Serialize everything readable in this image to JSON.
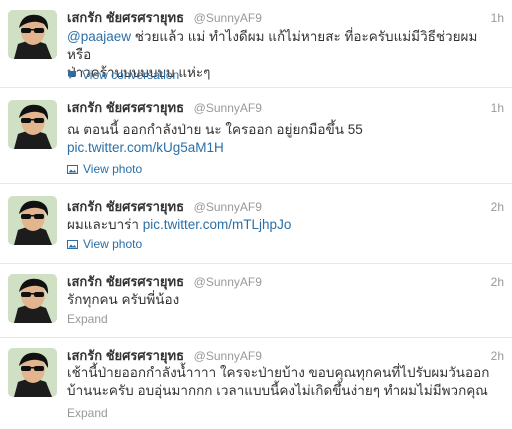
{
  "tweets": [
    {
      "fullname": "เสกรัก ชัยศรศรายุทธ",
      "username": "@SunnyAF9",
      "time": "1h",
      "mention": "@paajaew",
      "text": "ช่วยแล้ว แม่ ทำไงดีผม แก้ไม่หายสะ ที่อะครับแม่มีวิธีช่วยผมหรือ",
      "text2": "ป่าวคร้าบบบบบบบ แห่ะๆ",
      "action": "View conversation",
      "action_icon": "speech-bubble-icon"
    },
    {
      "fullname": "เสกรัก ชัยศรศรายุทธ",
      "username": "@SunnyAF9",
      "time": "1h",
      "text": "ณ ตอนนี้ ออกกำลังป่าย นะ ใครออก อยู่ยกมือขึ้น 55",
      "link": "pic.twitter.com/kUg5aM1H",
      "action": "View photo",
      "action_icon": "photo-icon"
    },
    {
      "fullname": "เสกรัก ชัยศรศรายุทธ",
      "username": "@SunnyAF9",
      "time": "2h",
      "text": "ผมและบาร่า",
      "link": "pic.twitter.com/mTLjhpJo",
      "action": "View photo",
      "action_icon": "photo-icon"
    },
    {
      "fullname": "เสกรัก ชัยศรศรายุทธ",
      "username": "@SunnyAF9",
      "time": "2h",
      "text": "รักทุกคน ครับพี่น้อง",
      "action": "Expand"
    },
    {
      "fullname": "เสกรัก ชัยศรศรายุทธ",
      "username": "@SunnyAF9",
      "time": "2h",
      "text": "เช้านี้ป่ายออกกำลังน้ำาาา ใครจะป่ายบ้าง ขอบคุณทุกคนที่ไปรับผมวันออก",
      "text2": "บ้านนะครับ อบอุ่นมากกก เวลาแบบนี้คงไม่เกิดขึ้นง่ายๆ ทำผมไม่มีพวกคุณ",
      "action": "Expand"
    }
  ]
}
